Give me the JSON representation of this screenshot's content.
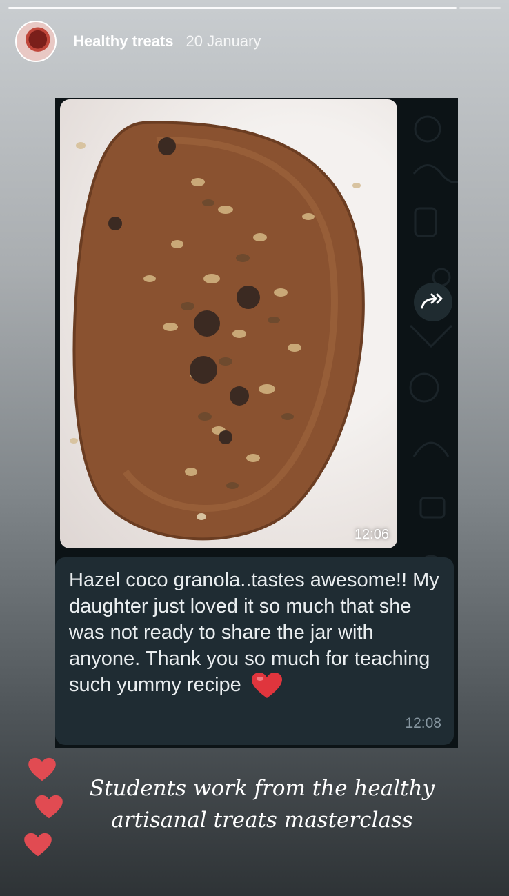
{
  "story": {
    "username": "Healthy treats",
    "date": "20 January"
  },
  "chat": {
    "photo_time": "12:06",
    "message": "Hazel coco granola..tastes awesome!! My daughter just loved it so much that she was not ready to share the jar with anyone. Thank you so much for teaching such yummy recipe",
    "message_emoji": "heart",
    "message_time": "12:08"
  },
  "caption": {
    "line1": "Students work from the healthy",
    "line2": "artisanal treats masterclass"
  },
  "colors": {
    "chat_background": "#0c1316",
    "bubble": "#1f2c33",
    "heart": "#e0353d",
    "timestamp": "#8696a0"
  },
  "icons": [
    "story-progress-bar",
    "avatar",
    "forward-icon",
    "heart-emoji",
    "heart-sticker"
  ]
}
